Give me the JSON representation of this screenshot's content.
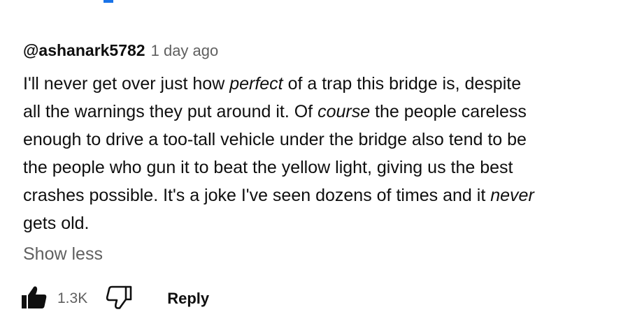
{
  "comment": {
    "author": "@ashanark5782",
    "timestamp": "1 day ago",
    "body": {
      "l1_a": "I'll never get over just how ",
      "l1_em": "perfect",
      "l1_b": " of a trap this bridge is, despite",
      "l2_a": "all the warnings they put around it. Of ",
      "l2_em": "course",
      "l2_b": " the people careless",
      "l3": "enough to drive a too-tall vehicle under the bridge also tend to be",
      "l4": "the people who gun it to beat the yellow light, giving us the best",
      "l5_a": "crashes possible. It's a joke I've seen dozens of times and it ",
      "l5_em": "never",
      "l6": "gets old."
    },
    "show_less_label": "Show less"
  },
  "actions": {
    "like_icon": "thumbs-up-filled-icon",
    "like_count": "1.3K",
    "dislike_icon": "thumbs-down-outline-icon",
    "reply_label": "Reply"
  },
  "colors": {
    "text_primary": "#0f0f0f",
    "text_secondary": "#606060",
    "accent": "#1a73e8"
  }
}
